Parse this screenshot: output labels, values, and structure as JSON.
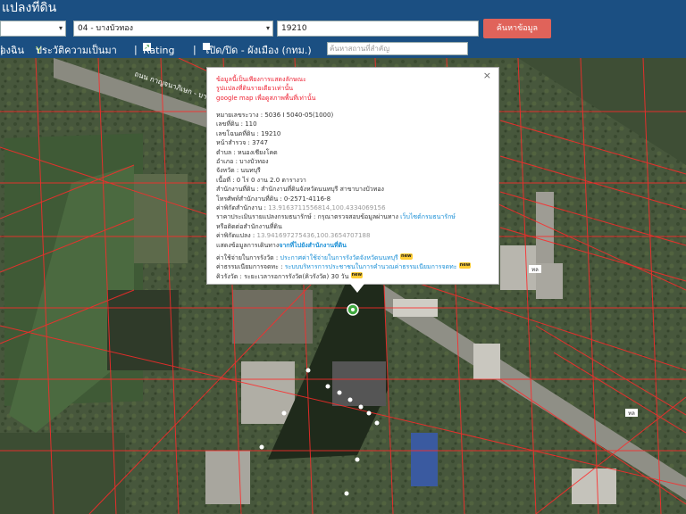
{
  "header": {
    "title": "แปลงที่ดิน"
  },
  "search": {
    "province_select": "",
    "district_select": "04 - บางบัวทอง",
    "parcel_input": "19210",
    "search_button": "ค้นหาข้อมูล"
  },
  "toolbar": {
    "layer_label": "องฉิน",
    "history_label": "ประวัติความเป็นมา",
    "rating_label": "Rating",
    "zoning_label": "เปิด/ปิด - ผังเมือง (กทม.)",
    "place_search_placeholder": "ค้นหาสถานที่สำคัญ"
  },
  "popup": {
    "close": "×",
    "warning_lines": [
      "ข้อมูลนี้เป็นเพียงการแสดงลักษณะ",
      "รูปแปลงที่ดินรายเดียวเท่านั้น",
      "google map เพื่อดูสภาพพื้นที่เท่านั้น"
    ],
    "map_sheet": "หมายเลขระวาง : 5036 I 5040-05(1000)",
    "parcel_no": "เลขที่ดิน : 110",
    "deed_no": "เลขโฉนดที่ดิน : 19210",
    "survey_page": "หน้าสำรวจ : 3747",
    "tambon": "ตำบล : หนองเชียงโคด",
    "amphoe": "อำเภอ : บางบัวทอง",
    "province": "จังหวัด : นนทบุรี",
    "area": "เนื้อที่ : 0 ไร่ 0 งาน 2.0 ตารางวา",
    "office": "สำนักงานที่ดิน : สำนักงานที่ดินจังหวัดนนทบุรี สาขาบางบัวทอง",
    "phone": "โทรศัพท์สำนักงานที่ดิน : 0-2571-4116-8",
    "office_coord_label": "ค่าพิกัดสำนักงาน :",
    "office_coord_value": "13.9163711556814,100.4334069156",
    "appraisal_label": "ราคาประเมินรายแปลงกรมธนารักษ์ : กรุณาตรวจสอบข้อมูลผ่านทาง",
    "appraisal_link": "เว็บไซต์กรมธนารักษ์",
    "appraisal_line2": "หรือติดต่อสำนักงานที่ดิน",
    "parcel_coord_label": "ค่าพิกัดแปลง :",
    "parcel_coord_value": "13.941697275436,100.3654707188",
    "route_label": "แสดงข้อมูลการเดินทาง",
    "route_link": "จากที่ไปยังสำนักงานที่ดิน",
    "extra": [
      {
        "label": "ค่าใช้จ่ายในการรังวัด :",
        "link": "ประกาศค่าใช้จ่ายในการรังวัดจังหวัดนนทบุรี",
        "badge": "new"
      },
      {
        "label": "ค่าธรรมเนียมการจดทะ :",
        "link": "ระบบบริหารการประชาชนในการคำนวณค่าธรรมเนียมการจดทะ",
        "badge": "new"
      },
      {
        "label": "คิวรังวัด : ระยะเวลารอการรังวัด(คิวรังวัด)",
        "link": "30 วัน",
        "badge": "new"
      }
    ]
  },
  "map_labels": {
    "road_label": "ถนน กาญจนาภิเษก - บางบัวทอง",
    "road_marker": "ทล"
  },
  "colors": {
    "header_bg": "#1b4f82",
    "button_bg": "#e0635a",
    "parcel_line": "#ff2a2a",
    "popup_warning": "#e23"
  }
}
